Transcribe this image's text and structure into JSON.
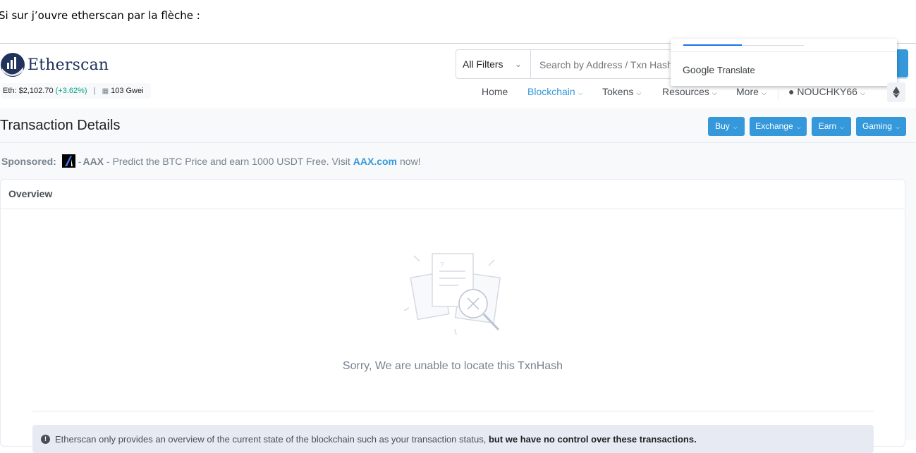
{
  "caption": "Si sur j’ouvre etherscan par la flèche :",
  "header": {
    "logo_text": "Etherscan",
    "price_label": "Eth: $2,102.70",
    "price_change": "(+3.62%)",
    "separator": "|",
    "gas": "103 Gwei"
  },
  "search": {
    "filter_label": "All Filters",
    "placeholder": "Search by Address / Txn Hash /"
  },
  "google_translate": {
    "label_brand": "Google",
    "label_name": "Translate"
  },
  "nav": {
    "home": "Home",
    "blockchain": "Blockchain",
    "tokens": "Tokens",
    "resources": "Resources",
    "more": "More",
    "user": "NOUCHKY66"
  },
  "page": {
    "title": "Transaction Details",
    "buttons": {
      "buy": "Buy",
      "exchange": "Exchange",
      "earn": "Earn",
      "gaming": "Gaming"
    }
  },
  "sponsored": {
    "label": "Sponsored:",
    "dash1": "-",
    "brand": "AAX",
    "text": "- Predict the BTC Price and earn 1000 USDT Free. Visit",
    "link": "AAX.com",
    "suffix": "now!"
  },
  "overview": {
    "heading": "Overview",
    "message": "Sorry, We are unable to locate this TxnHash",
    "alert_text": "Etherscan only provides an overview of the current state of the blockchain such as your transaction status,",
    "alert_bold": "but we have no control over these transactions."
  },
  "colors": {
    "accent": "#3498db",
    "brand_navy": "#21325b",
    "positive": "#00a186"
  }
}
